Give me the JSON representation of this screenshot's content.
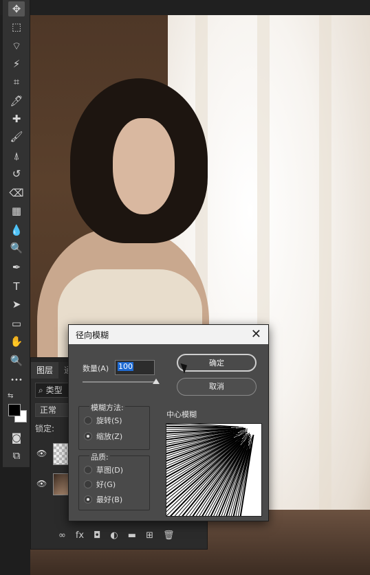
{
  "toolbar": {
    "tools": [
      {
        "name": "move-tool-icon",
        "glyph": "✥"
      },
      {
        "name": "marquee-tool-icon",
        "glyph": "⬚"
      },
      {
        "name": "lasso-tool-icon",
        "glyph": "⌔"
      },
      {
        "name": "magic-wand-tool-icon",
        "glyph": "⚡"
      },
      {
        "name": "crop-tool-icon",
        "glyph": "⌗"
      },
      {
        "name": "eyedropper-tool-icon",
        "glyph": "🖊"
      },
      {
        "name": "healing-brush-tool-icon",
        "glyph": "✚"
      },
      {
        "name": "brush-tool-icon",
        "glyph": "🖌"
      },
      {
        "name": "clone-stamp-tool-icon",
        "glyph": "⍋"
      },
      {
        "name": "history-brush-tool-icon",
        "glyph": "↺"
      },
      {
        "name": "eraser-tool-icon",
        "glyph": "⌫"
      },
      {
        "name": "gradient-tool-icon",
        "glyph": "▦"
      },
      {
        "name": "blur-tool-icon",
        "glyph": "💧"
      },
      {
        "name": "dodge-tool-icon",
        "glyph": "🔍"
      },
      {
        "name": "pen-tool-icon",
        "glyph": "✒"
      },
      {
        "name": "type-tool-icon",
        "glyph": "T"
      },
      {
        "name": "path-selection-tool-icon",
        "glyph": "➤"
      },
      {
        "name": "rectangle-tool-icon",
        "glyph": "▭"
      },
      {
        "name": "hand-tool-icon",
        "glyph": "✋"
      },
      {
        "name": "zoom-tool-icon",
        "glyph": "🔍"
      },
      {
        "name": "more-tools-icon",
        "glyph": "•••"
      }
    ]
  },
  "layers_panel": {
    "tab_layers": "图层",
    "tab_other": "通",
    "search_label": "类型",
    "blend_mode": "正常",
    "lock_label": "锁定:"
  },
  "dialog": {
    "title": "径向模糊",
    "amount_label": "数量(A)",
    "amount_value": "100",
    "ok_label": "确定",
    "cancel_label": "取消",
    "method_group": "模糊方法:",
    "method_spin": "旋转(S)",
    "method_zoom": "缩放(Z)",
    "quality_group": "品质:",
    "quality_draft": "草图(D)",
    "quality_good": "好(G)",
    "quality_best": "最好(B)",
    "center_label": "中心模糊",
    "selected_method": "zoom",
    "selected_quality": "best"
  }
}
